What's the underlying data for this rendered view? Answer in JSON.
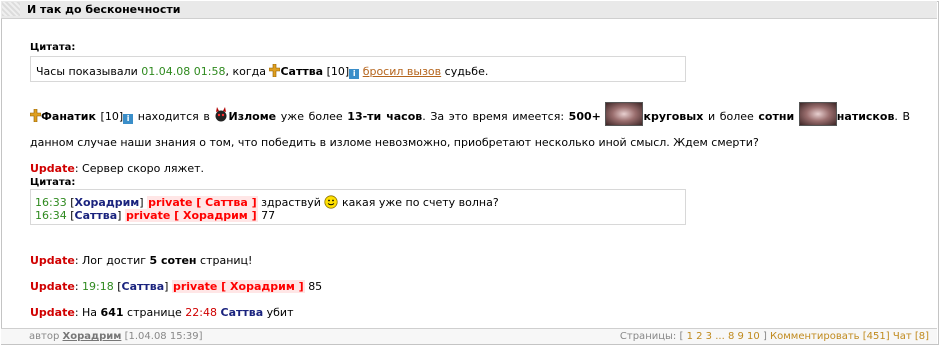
{
  "post": {
    "title": "И так до бесконечности"
  },
  "quote1": {
    "label": "Цитата:",
    "text_before": "Часы показывали",
    "datetime": "01.04.08 01:58",
    "text_mid": ", когда",
    "user": "Саттва",
    "level": "[10]",
    "link": "бросил вызов",
    "text_after": "судьбе."
  },
  "para1": {
    "user": "Фанатик",
    "level": "[10]",
    "t1": "находится в",
    "place": "Изломе",
    "t2": "уже более",
    "dur": "13-ти часов",
    "t3": ". За это время имеется:",
    "count1": "500+",
    "item1": "круговых",
    "t4": "и более",
    "count2": "сотни",
    "item2": "натисков",
    "t5": ". В данном случае наши знания о том, что победить в изломе невозможно, приобретают несколько иной смысл. Ждем смерти?"
  },
  "update1": {
    "label": "Update",
    "text": ": Сервер скоро ляжет."
  },
  "quote2": {
    "label": "Цитата:",
    "lines": [
      {
        "time": "16:33",
        "user": "Хорадрим",
        "priv": "private [ Саттва ]",
        "text": "здраствуй",
        "text2": "какая уже по счету волна?"
      },
      {
        "time": "16:34",
        "user": "Саттва",
        "priv": "private [ Хорадрим ]",
        "text": "77"
      }
    ]
  },
  "update2": {
    "label": "Update",
    "t1": ": Лог достиг",
    "bold": "5 сотен",
    "t2": "страниц!"
  },
  "update3": {
    "label": "Update",
    "time": "19:18",
    "user": "Саттва",
    "priv": "private [ Хорадрим ]",
    "text": "85"
  },
  "update4": {
    "label": "Update",
    "t1": ": На",
    "bold": "641",
    "t2": "странице",
    "time": "22:48",
    "user": "Саттва",
    "t3": "убит"
  },
  "footer": {
    "author_label": "автор",
    "author": "Хорадрим",
    "date": "[1.04.08 15:39]",
    "pages_label": "Страницы: [",
    "pages_a": "1 2 3",
    "pages_dots": "...",
    "pages_b": "8 9 10",
    "pages_close": "]",
    "comment": "Комментировать [451]",
    "chat": "Чат [8]"
  },
  "colors": {
    "green": "#2f8a1f",
    "red": "#d00000",
    "navy": "#1a237e",
    "link": "#b5651d"
  }
}
